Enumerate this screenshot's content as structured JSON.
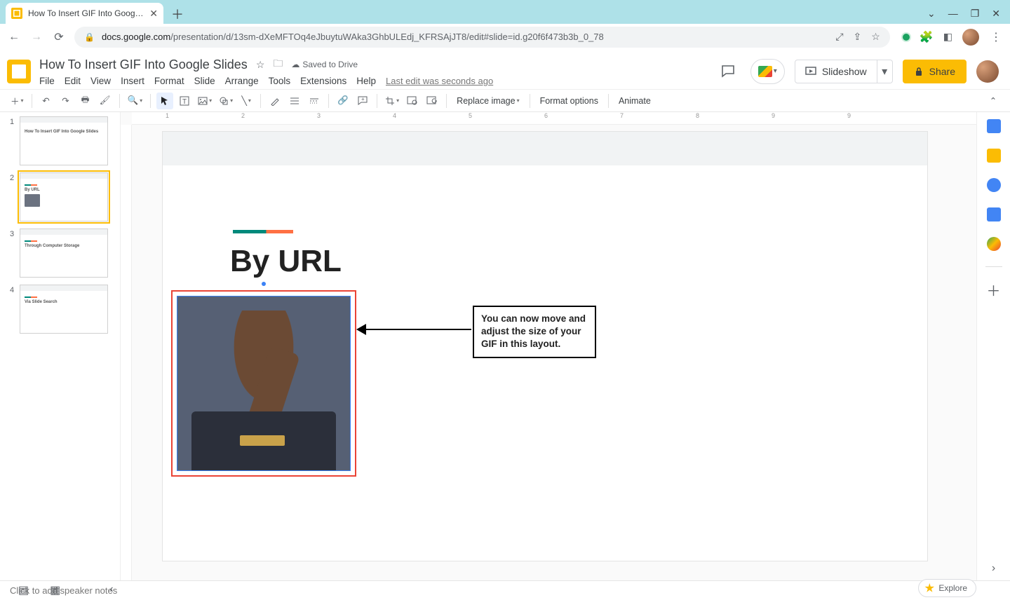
{
  "browser": {
    "tab_title": "How To Insert GIF Into Google Sli",
    "url_host": "docs.google.com",
    "url_path": "/presentation/d/13sm-dXeMFTOq4eJbuytuWAka3GhbULEdj_KFRSAjJT8/edit#slide=id.g20f6f473b3b_0_78",
    "win_controls": {
      "min": "—",
      "max": "❐",
      "close": "✕",
      "chev": "⌄"
    }
  },
  "doc": {
    "title": "How To Insert GIF Into Google Slides",
    "saved_label": "Saved to Drive",
    "menus": {
      "file": "File",
      "edit": "Edit",
      "view": "View",
      "insert": "Insert",
      "format": "Format",
      "slide": "Slide",
      "arrange": "Arrange",
      "tools": "Tools",
      "extensions": "Extensions",
      "help": "Help"
    },
    "last_edit": "Last edit was seconds ago",
    "slideshow_label": "Slideshow",
    "share_label": "Share"
  },
  "toolbar": {
    "replace_image": "Replace image",
    "format_options": "Format options",
    "animate": "Animate"
  },
  "ruler_marks": [
    "1",
    "2",
    "3",
    "4",
    "5",
    "6",
    "7",
    "8",
    "9",
    "9"
  ],
  "thumbs": [
    {
      "num": "1",
      "title": "How To Insert GIF Into Google Slides"
    },
    {
      "num": "2",
      "title": "By URL"
    },
    {
      "num": "3",
      "title": "Through Computer Storage"
    },
    {
      "num": "4",
      "title": "Via Slide Search"
    }
  ],
  "slide": {
    "heading": "By URL",
    "callout": "You can now move and adjust the size of your GIF in this layout."
  },
  "notes_placeholder": "Click to add speaker notes",
  "explore_label": "Explore"
}
